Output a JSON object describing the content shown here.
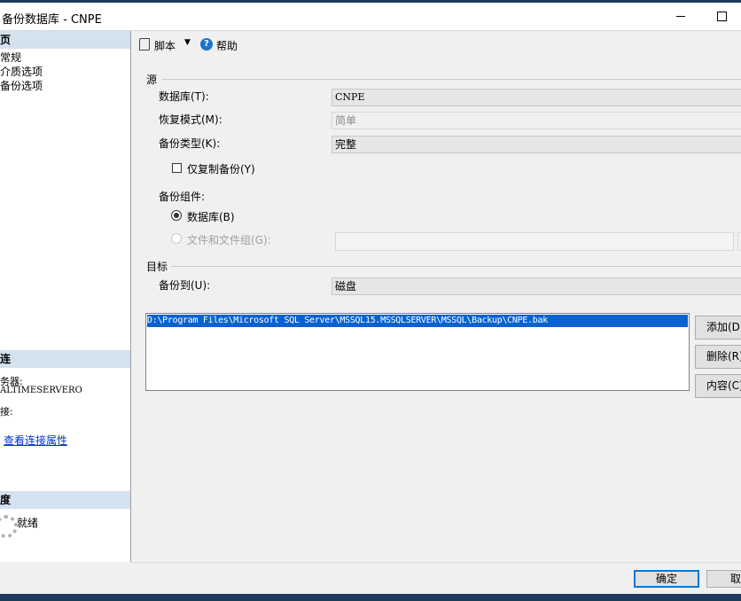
{
  "window": {
    "title": "备份数据库 - CNPE"
  },
  "left_pane": {
    "select_page_header": "页",
    "nav_items": [
      "常规",
      "介质选项",
      "备份选项"
    ],
    "connection_header": "连",
    "server_label": "务器:",
    "server_value": "ALTIMESERVERO",
    "connection_label": "接:",
    "view_conn_link": "查看连接属性",
    "progress_header": "度",
    "progress_status": "就绪"
  },
  "toolbar": {
    "script_label": "脚本",
    "help_label": "帮助"
  },
  "source": {
    "title": "源",
    "database_label": "数据库(T):",
    "database_value": "CNPE",
    "recovery_label": "恢复模式(M):",
    "recovery_value": "简单",
    "backup_type_label": "备份类型(K):",
    "backup_type_value": "完整",
    "copy_only_label": "仅复制备份(Y)",
    "copy_only_checked": false,
    "component_label": "备份组件:",
    "component_options": [
      {
        "label": "数据库(B)",
        "checked": true,
        "enabled": true
      },
      {
        "label": "文件和文件组(G):",
        "checked": false,
        "enabled": false
      }
    ]
  },
  "destination": {
    "title": "目标",
    "backup_to_label": "备份到(U):",
    "backup_to_value": "磁盘",
    "paths": [
      "D:\\Program Files\\Microsoft SQL Server\\MSSQL15.MSSQLSERVER\\MSSQL\\Backup\\CNPE.bak"
    ],
    "add_button": "添加(D)",
    "remove_button": "删除(R)",
    "contents_button": "内容(C)"
  },
  "buttons": {
    "ok": "确定",
    "cancel": "取"
  }
}
